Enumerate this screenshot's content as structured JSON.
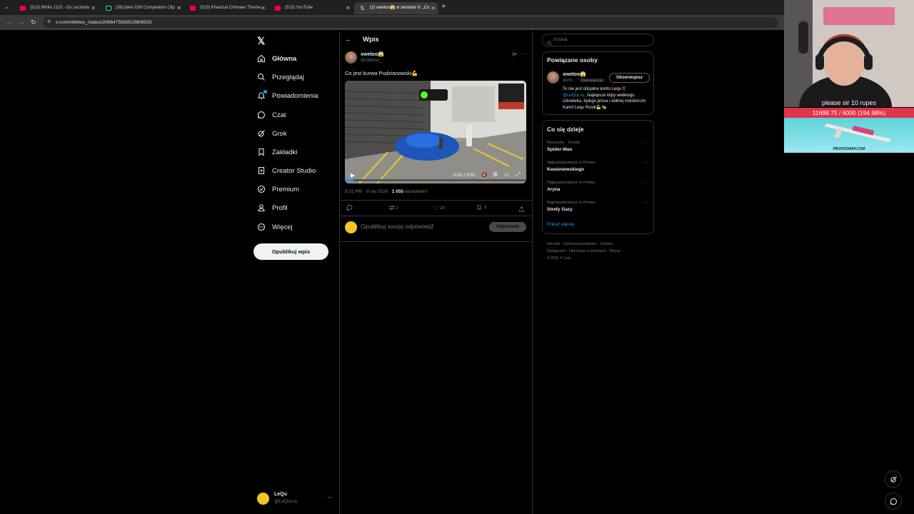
{
  "browser": {
    "tabs": [
      {
        "title": "(513) White 2115 - Do zachodu",
        "favicon": "youtube"
      },
      {
        "title": "(36)Joker Edit Compilation Clip",
        "favicon": "tiktok"
      },
      {
        "title": "(513) Khamzat Chimaev Theme",
        "favicon": "youtube"
      },
      {
        "title": "(513) YouTube",
        "favicon": "youtube"
      },
      {
        "title": "(2) xwetoo😱 w serwisie X: „Co",
        "favicon": "x",
        "active": true
      }
    ],
    "url": "x.com/xWetoo_/status/2086475393519808533"
  },
  "nav": {
    "items": [
      {
        "label": "Główna",
        "icon": "home-icon"
      },
      {
        "label": "Przeglądaj",
        "icon": "search-icon"
      },
      {
        "label": "Powiadomienia",
        "icon": "bell-icon",
        "badge": true
      },
      {
        "label": "Czat",
        "icon": "chat-icon"
      },
      {
        "label": "Grok",
        "icon": "grok-icon"
      },
      {
        "label": "Zakładki",
        "icon": "bookmark-icon"
      },
      {
        "label": "Creator Studio",
        "icon": "creator-studio-icon"
      },
      {
        "label": "Premium",
        "icon": "premium-icon"
      },
      {
        "label": "Profil",
        "icon": "profile-icon"
      },
      {
        "label": "Więcej",
        "icon": "more-icon"
      }
    ],
    "post_button": "Opublikuj wpis",
    "account": {
      "name": "LeQu",
      "handle": "@LeQuLoL"
    }
  },
  "main": {
    "header": "Wpis",
    "post": {
      "author": "xwetoo😱",
      "handle": "@xWetoo_",
      "text": "Co jest kurwa Pudzianowski💪",
      "video_time": "0:02 / 0:51",
      "timestamp": "5:31 PM · 9 sie 2026 · ",
      "views_count": "1 055",
      "views_label": "wyświetleń",
      "reposts": "2",
      "likes": "14",
      "bookmarks": "3"
    },
    "reply_placeholder": "Opublikuj swoją odpowiedź",
    "reply_button": "Odpowiedz"
  },
  "sidebar": {
    "search_placeholder": "Szukaj",
    "related": {
      "title": "Powiązane osoby",
      "name": "xwetoo😱",
      "handle": "@xW...",
      "follows_you": "Obserwuje Cię",
      "follow_button": "Obserwujesz",
      "bio_mention": "@LeQuLoL",
      "bio_prefix": "To nie jest oficjalne konto Lequ‼️",
      "bio_rest": "Najlepsze klipy wielkiego człowieka, bylego prosa i dobrej morderczki Kamil Lequ Rosik💪🐄"
    },
    "trends": {
      "title": "Co się dzieje",
      "items": [
        {
          "category": "Rozrywka · Trendy",
          "name": "Spider-Man"
        },
        {
          "category": "Najpopularniejsze w Polska",
          "name": "Kwaśniewskiego"
        },
        {
          "category": "Najpopularniejsze w Polska",
          "name": "Aryna"
        },
        {
          "category": "Najpopularniejsze w Polska",
          "name": "Strefy Gazy"
        }
      ],
      "show_more": "Pokaż więcej"
    },
    "footer": {
      "line1": [
        "Warunki",
        "Ochrona prywatności",
        "Cookies"
      ],
      "line2": [
        "Dostępność",
        "Informacje o reklamach",
        "Więcej ···"
      ],
      "copyright": "© 2026 X Corp."
    }
  },
  "overlay": {
    "donation_text": "please sir 10 rupes",
    "progress_text": "11698.75 / 6000 (194.98%)",
    "progress_fraction": 1.0,
    "sponsor": "PIRATESWAP.COM",
    "colors": {
      "progress": "#e0344a",
      "accent": "#1d9bf0"
    }
  }
}
